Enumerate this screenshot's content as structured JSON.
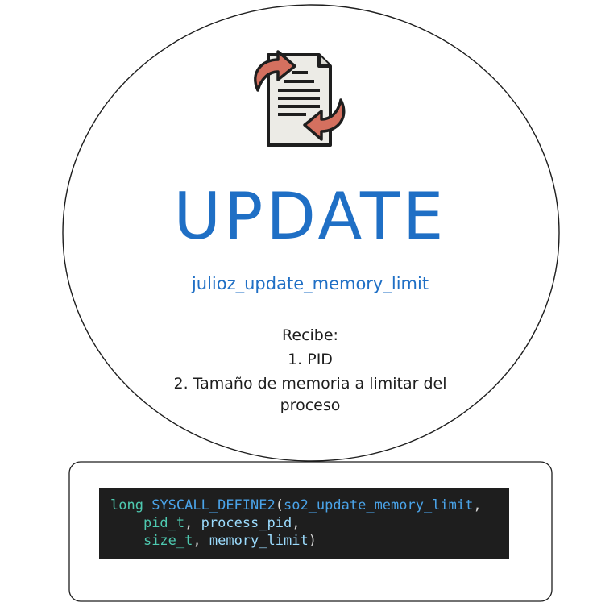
{
  "title": "UPDATE",
  "subtitle": "julioz_update_memory_limit",
  "receives": {
    "heading": "Recibe:",
    "items": [
      "1. PID",
      "2. Tamaño de memoria a limitar del",
      "proceso"
    ]
  },
  "code": {
    "line1": {
      "return_type": "long",
      "macro": "SYSCALL_DEFINE2",
      "open": "(",
      "name": "so2_update_memory_limit",
      "sep": ","
    },
    "line2": {
      "type": "pid_t",
      "sep1": ", ",
      "param": "process_pid",
      "sep2": ","
    },
    "line3": {
      "type": "size_t",
      "sep1": ", ",
      "param": "memory_limit",
      "close": ")"
    }
  },
  "icon": "document-update-icon",
  "colors": {
    "accent": "#1f6fc5",
    "arrow": "#d4705f",
    "document": "#ecebe6",
    "code_bg": "#1e1e1e",
    "code_keyword": "#4ec9b0",
    "code_function": "#4aa3e8"
  }
}
